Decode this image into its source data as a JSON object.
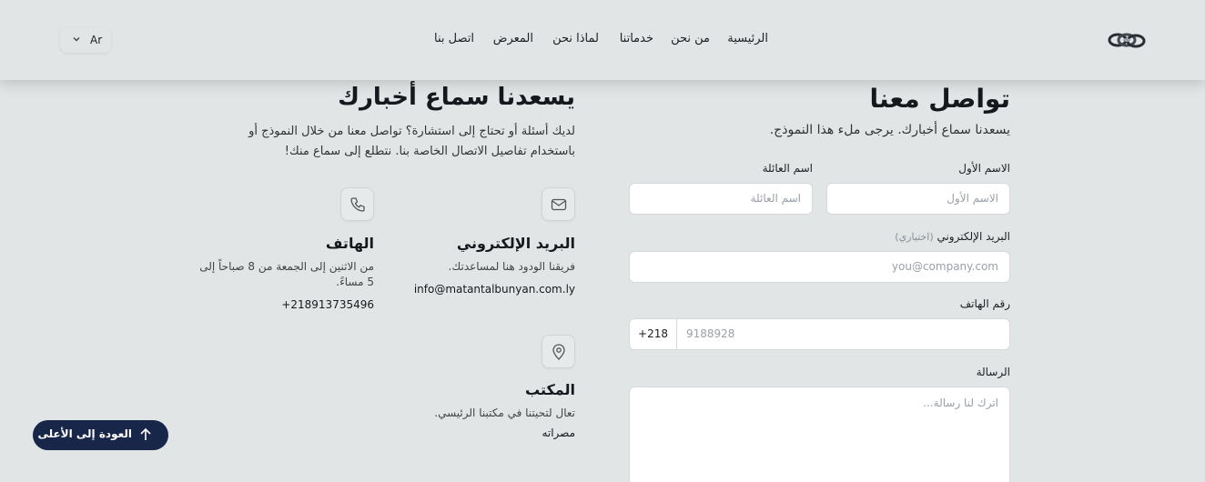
{
  "header": {
    "language": "Ar",
    "logo_icon": "chain-link-logo-icon",
    "nav": [
      {
        "label": "الرئيسية"
      },
      {
        "label": "من نحن"
      },
      {
        "label": "خدماتنا"
      },
      {
        "label": "لماذا نحن"
      },
      {
        "label": "المعرض"
      },
      {
        "label": "اتصل بنا"
      }
    ]
  },
  "form": {
    "title": "تواصل معنا",
    "subtitle": "يسعدنا سماع أخبارك. يرجى ملء هذا النموذج.",
    "first_name": {
      "label": "الاسم الأول",
      "placeholder": "الاسم الأول"
    },
    "last_name": {
      "label": "اسم العائلة",
      "placeholder": "اسم العائلة"
    },
    "email": {
      "label": "البريد الإلكتروني",
      "optional": "(اختياري)",
      "placeholder": "you@company.com"
    },
    "phone": {
      "label": "رقم الهاتف",
      "code": "+218",
      "placeholder": "9188928"
    },
    "message": {
      "label": "الرسالة",
      "placeholder": "اترك لنا رسالة..."
    }
  },
  "contact": {
    "title": "يسعدنا سماع أخبارك",
    "description": "لديك أسئلة أو تحتاج إلى استشارة؟ تواصل معنا من خلال النموذج أو باستخدام تفاصيل الاتصال الخاصة بنا. نتطلع إلى سماع منك!",
    "email": {
      "icon": "mail-icon",
      "title": "البريد الإلكتروني",
      "text": "فريقنا الودود هنا لمساعدتك.",
      "value": "info@matantalbunyan.com.ly"
    },
    "phone": {
      "icon": "phone-icon",
      "title": "الهاتف",
      "text": "من الاثنين إلى الجمعة من 8 صباحاً إلى 5 مساءً.",
      "value": "+218913735496"
    },
    "office": {
      "icon": "map-pin-icon",
      "title": "المكتب",
      "text": "تعال لتحيتنا في مكتبنا الرئيسي.",
      "value": "مصراته"
    }
  },
  "back_to_top": {
    "label": "العودة إلى الأعلى",
    "icon": "arrow-up-icon"
  },
  "colors": {
    "background": "#e1e5e5",
    "button": "#18264a",
    "text": "#16181d"
  }
}
